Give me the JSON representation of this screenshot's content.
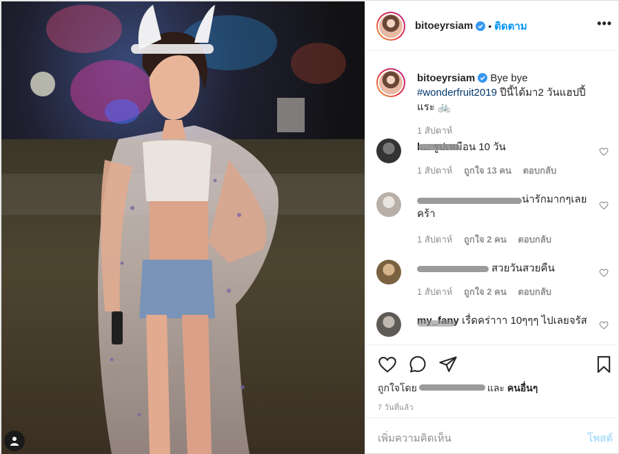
{
  "post": {
    "username": "bitoeyrsiam",
    "follow_label": "ติดตาม",
    "more_label": "•••",
    "caption": {
      "text_before": "Bye bye",
      "hashtag": "#wonderfruit2019",
      "text_after": " ปีนี้ได้มา2 วันแฮปปี้แระ 🚲"
    },
    "caption_time": "1 สัปดาห์"
  },
  "comments": [
    {
      "username": "l…",
      "text": "รูปเหมือน 10 วัน",
      "time": "1 สัปดาห์",
      "likes": "ถูกใจ 13 คน",
      "reply": "ตอบกลับ"
    },
    {
      "username": "",
      "text": "น่ารักมากๆเลยคร้า",
      "time": "1 สัปดาห์",
      "likes": "ถูกใจ 2 คน",
      "reply": "ตอบกลับ"
    },
    {
      "username": "",
      "text": "สวยวันสวยคืน",
      "time": "1 สัปดาห์",
      "likes": "ถูกใจ 2 คน",
      "reply": "ตอบกลับ"
    },
    {
      "username": "my_fany",
      "text": "เรื่ดคร่าาา 10ๆๆๆ ไปเลยจรัส",
      "time": "",
      "likes": "",
      "reply": ""
    }
  ],
  "actions": {
    "liked_by_prefix": "ถูกใจโดย",
    "liked_by_and": "และ",
    "liked_by_others": "คนอื่นๆ",
    "date": "7 วันที่แล้ว"
  },
  "add_comment": {
    "placeholder": "เพิ่มความคิดเห็น",
    "post_label": "โพสต์"
  },
  "colors": {
    "link_blue": "#0095f6",
    "hashtag": "#00376b",
    "muted": "#8e8e8e",
    "disabled_post": "#b2dffc"
  },
  "icons": [
    "user-tag-icon",
    "verified-icon",
    "heart-icon",
    "comment-icon",
    "share-icon",
    "bookmark-icon",
    "more-options-icon"
  ]
}
